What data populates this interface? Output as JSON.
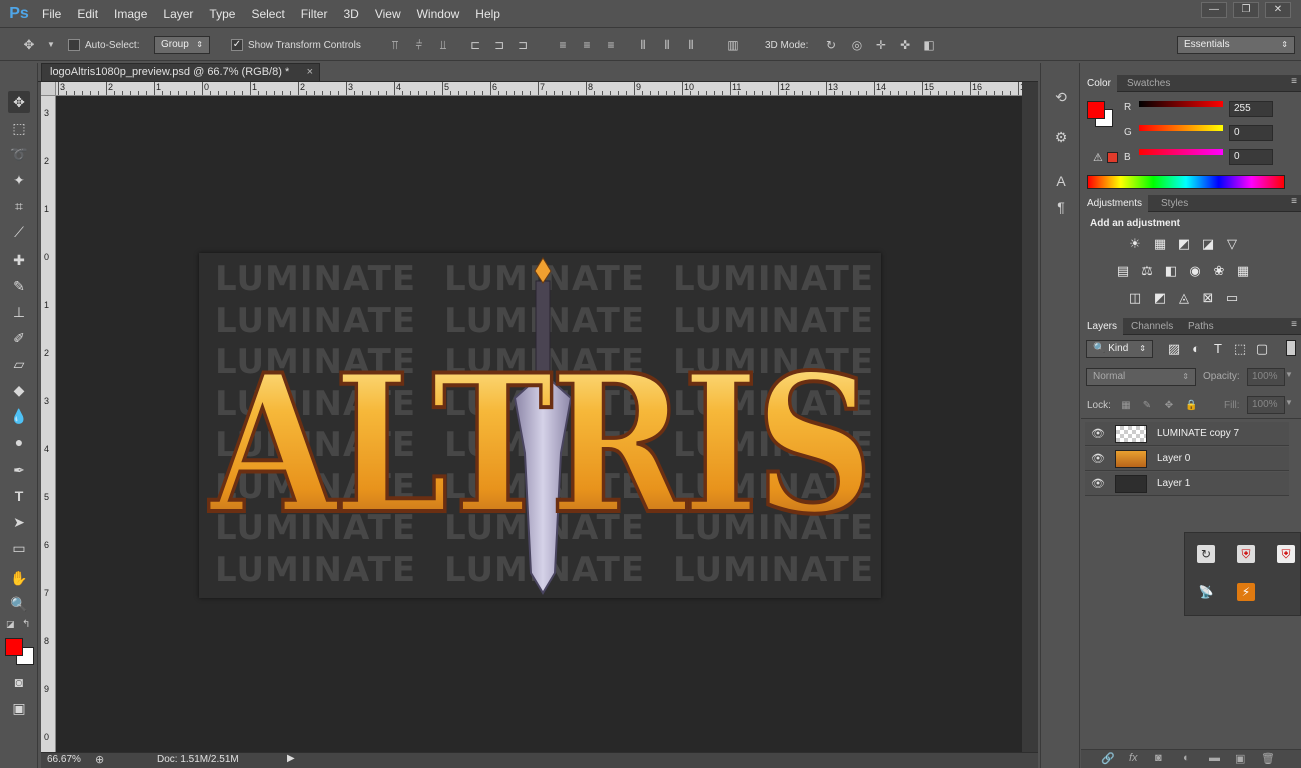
{
  "app": {
    "logo": "Ps"
  },
  "menu": [
    "File",
    "Edit",
    "Image",
    "Layer",
    "Type",
    "Select",
    "Filter",
    "3D",
    "View",
    "Window",
    "Help"
  ],
  "window_controls": {
    "minimize": "—",
    "restore": "❐",
    "close": "✕"
  },
  "options": {
    "auto_select_label": "Auto-Select:",
    "auto_select_checked": false,
    "group_value": "Group",
    "show_transform_label": "Show Transform Controls",
    "show_transform_checked": true,
    "mode_3d_label": "3D Mode:",
    "workspace": "Essentials"
  },
  "document": {
    "tab_title": "logoAltris1080p_preview.psd @ 66.7% (RGB/8) *",
    "close": "×",
    "watermark_text": "LUMINATE",
    "logo_text": "ALTRIS"
  },
  "ruler": {
    "h_labels": [
      "3",
      "2",
      "1",
      "0",
      "1",
      "2",
      "3",
      "4",
      "5",
      "6",
      "7",
      "8",
      "9",
      "10",
      "11",
      "12",
      "13",
      "14",
      "15",
      "16",
      "17",
      "18",
      "19",
      "20"
    ],
    "v_labels": [
      "3",
      "2",
      "1",
      "0",
      "1",
      "2",
      "3",
      "4",
      "5",
      "6",
      "7",
      "8",
      "9",
      "0"
    ]
  },
  "status": {
    "zoom": "66.67%",
    "doc_size": "Doc: 1.51M/2.51M"
  },
  "color_panel": {
    "tabs": [
      "Color",
      "Swatches"
    ],
    "foreground": "#ff0000",
    "background": "#ffffff",
    "channels": [
      {
        "label": "R",
        "value": "255"
      },
      {
        "label": "G",
        "value": "0"
      },
      {
        "label": "B",
        "value": "0"
      }
    ]
  },
  "adjustments_panel": {
    "tabs": [
      "Adjustments",
      "Styles"
    ],
    "heading": "Add an adjustment"
  },
  "layers_panel": {
    "tabs": [
      "Layers",
      "Channels",
      "Paths"
    ],
    "filter_kind": "Kind",
    "blend_mode": "Normal",
    "opacity_label": "Opacity:",
    "opacity_value": "100%",
    "lock_label": "Lock:",
    "fill_label": "Fill:",
    "fill_value": "100%",
    "layers": [
      {
        "name": "LUMINATE copy 7",
        "visible": true
      },
      {
        "name": "Layer 0",
        "visible": true
      },
      {
        "name": "Layer 1",
        "visible": true
      }
    ]
  }
}
